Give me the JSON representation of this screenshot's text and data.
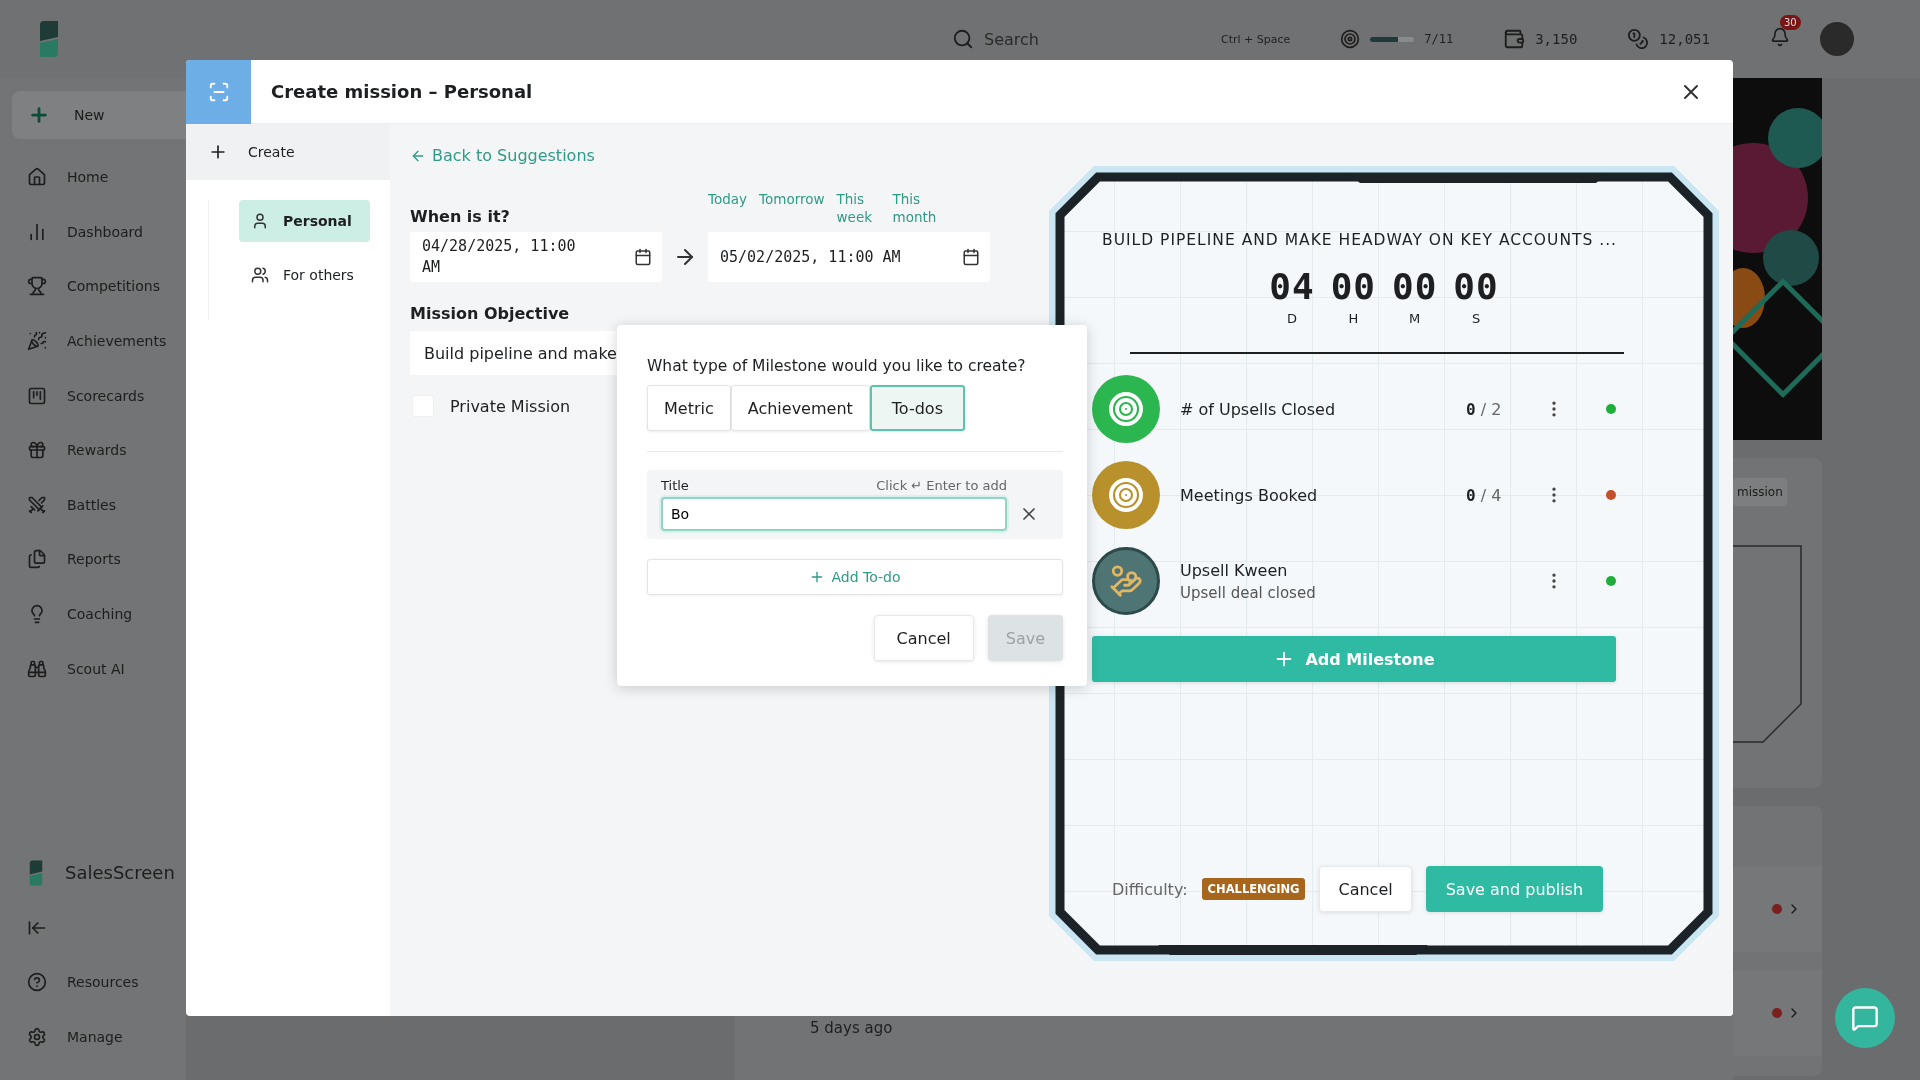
{
  "topbar": {
    "search_placeholder": "Search",
    "shortcut": "Ctrl + Space",
    "progress": {
      "level": 0.64,
      "reading": "7/11"
    },
    "coins": "3,150",
    "points": "12,051",
    "notifications": "30"
  },
  "sidebar": {
    "new_label": "New",
    "items": [
      "Home",
      "Dashboard",
      "Competitions",
      "Achievements",
      "Scorecards",
      "Rewards",
      "Battles",
      "Reports",
      "Coaching",
      "Scout AI"
    ],
    "brand": "SalesScreen",
    "footer_items": [
      "Resources",
      "Manage"
    ]
  },
  "background": {
    "mission_button": "mission",
    "activity_time": "5 days ago",
    "rows": [
      {
        "color": "#7a1f1f"
      },
      {
        "color": "#7a1f1f"
      }
    ]
  },
  "modal": {
    "title": "Create mission – Personal",
    "create_label": "Create",
    "nav": [
      {
        "label": "Personal",
        "selected": true
      },
      {
        "label": "For others",
        "selected": false
      }
    ],
    "back_link": "Back to Suggestions",
    "when_label": "When is it?",
    "quick_dates": [
      "Today",
      "Tomorrow",
      "This week",
      "This month"
    ],
    "start": "04/28/2025, 11:00 AM",
    "end": "05/02/2025, 11:00 AM",
    "objective_label": "Mission Objective",
    "objective_value": "Build pipeline and make",
    "private": {
      "label": "Private Mission",
      "checked": false
    }
  },
  "popup": {
    "question": "What type of Milestone would you like to create?",
    "types": [
      {
        "label": "Metric",
        "selected": false
      },
      {
        "label": "Achievement",
        "selected": false
      },
      {
        "label": "To-dos",
        "selected": true
      }
    ],
    "title_label": "Title",
    "hint": "Click ↵ Enter to add",
    "title_value": "Bo",
    "add_label": "Add To-do",
    "cancel": "Cancel",
    "save": {
      "label": "Save",
      "disabled": true
    }
  },
  "card": {
    "title": "BUILD PIPELINE AND MAKE HEADWAY ON KEY ACCOUNTS ...",
    "countdown": [
      {
        "value": "04",
        "unit": "D"
      },
      {
        "value": "00",
        "unit": "H"
      },
      {
        "value": "00",
        "unit": "M"
      },
      {
        "value": "00",
        "unit": "S"
      }
    ],
    "milestones": [
      {
        "kind": "metric",
        "name": "# of Upsells Closed",
        "count": "**0** / 2",
        "icon": {
          "color": "#2cb64f"
        },
        "color": "#1fae3c"
      },
      {
        "kind": "metric",
        "name": "Meetings Booked",
        "count": "**0** / 4",
        "icon": {
          "color": "#b8912c"
        },
        "color": "#c4502a"
      },
      {
        "kind": "achievement",
        "name": "Upsell Kween",
        "subtitle": "Upsell deal closed",
        "color": "#1fae3c"
      }
    ],
    "add_label": "Add Milestone",
    "difficulty_label": "Difficulty:",
    "difficulty": "CHALLENGING",
    "cancel": "Cancel",
    "publish": "Save and publish"
  }
}
